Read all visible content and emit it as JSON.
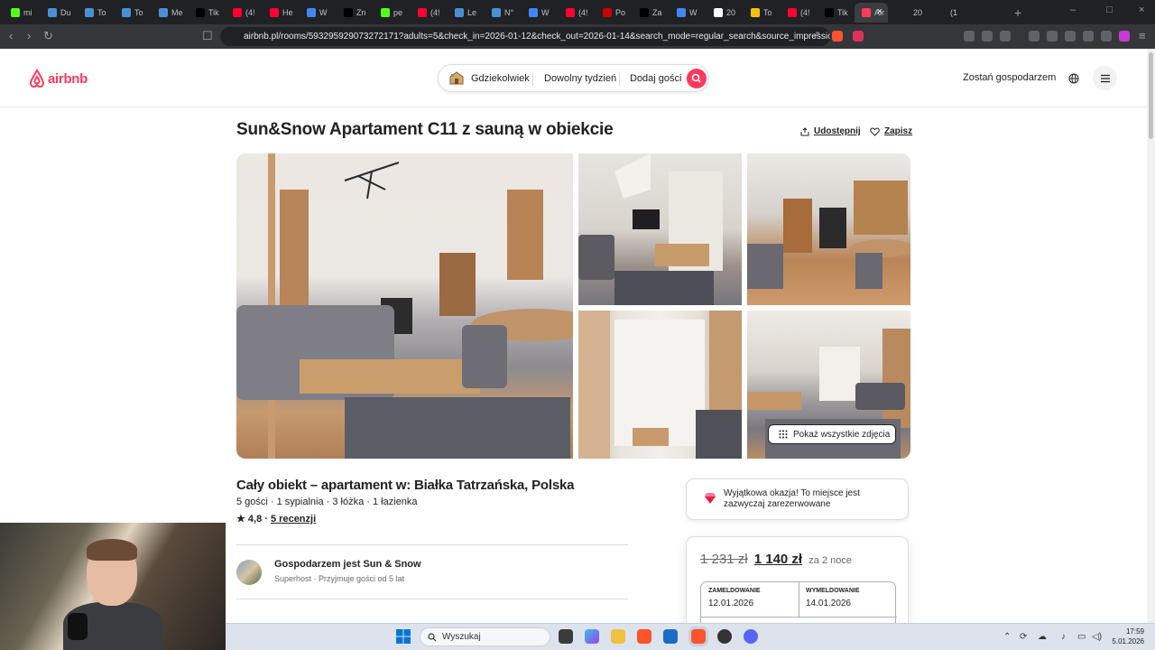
{
  "browser": {
    "tabs": [
      {
        "label": "mi",
        "color": "#53fc18"
      },
      {
        "label": "Du",
        "color": "#4a8fd4"
      },
      {
        "label": "To",
        "color": "#4a8fd4"
      },
      {
        "label": "To",
        "color": "#4a8fd4"
      },
      {
        "label": "Me",
        "color": "#4a8fd4"
      },
      {
        "label": "Tik",
        "color": "#000000"
      },
      {
        "label": "(4!",
        "color": "#ff0033"
      },
      {
        "label": "He",
        "color": "#ff0033"
      },
      {
        "label": "W",
        "color": "#4285f4"
      },
      {
        "label": "Zn",
        "color": "#000000"
      },
      {
        "label": "pe",
        "color": "#53fc18"
      },
      {
        "label": "(4!",
        "color": "#ff0033"
      },
      {
        "label": "Le",
        "color": "#4a8fd4"
      },
      {
        "label": "N°",
        "color": "#4a8fd4"
      },
      {
        "label": "W",
        "color": "#4285f4"
      },
      {
        "label": "(4!",
        "color": "#ff0033"
      },
      {
        "label": "Po",
        "color": "#cc0000"
      },
      {
        "label": "Za",
        "color": "#000000"
      },
      {
        "label": "W",
        "color": "#4285f4"
      },
      {
        "label": "20",
        "color": "#ffffff"
      },
      {
        "label": "To",
        "color": "#f4c20d"
      },
      {
        "label": "(4!",
        "color": "#ff0033"
      },
      {
        "label": "Tik",
        "color": "#000000"
      },
      {
        "label": "Air",
        "color": "#ff385c"
      }
    ],
    "extra_tabs": [
      {
        "label": "20"
      },
      {
        "label": "(1"
      }
    ],
    "url": "airbnb.pl/rooms/593295929073272171?adults=5&check_in=2026-01-12&check_out=2026-01-14&search_mode=regular_search&source_impression..."
  },
  "header": {
    "logo_text": "airbnb",
    "search": {
      "where": "Gdziekolwiek",
      "when": "Dowolny tydzień",
      "guests": "Dodaj gości"
    },
    "host_link": "Zostań gospodarzem"
  },
  "listing": {
    "title": "Sun&Snow Apartament C11 z sauną w obiekcie",
    "share_label": "Udostępnij",
    "save_label": "Zapisz",
    "show_all_photos": "Pokaż wszystkie zdjęcia",
    "subtitle": "Cały obiekt – apartament w: Białka Tatrzańska, Polska",
    "details": "5 gości · 1 sypialnia · 3 łóżka · 1 łazienka",
    "rating": "★ 4,8 ·",
    "reviews": "5 recenzji",
    "host_title": "Gospodarzem jest Sun & Snow",
    "host_sub": "Superhost · Przyjmuje gości od 5 lat"
  },
  "booking": {
    "deal_text": "Wyjątkowa okazja! To miejsce jest zazwyczaj zarezerwowane",
    "price_old": "1 231 zł",
    "price_new": "1 140 zł",
    "nights": "za 2 noce",
    "checkin_label": "ZAMELDOWANIE",
    "checkin_value": "12.01.2026",
    "checkout_label": "WYMELDOWANIE",
    "checkout_value": "14.01.2026"
  },
  "taskbar": {
    "search_placeholder": "Wyszukaj",
    "time": "17:59",
    "date": "5.01.2026"
  }
}
